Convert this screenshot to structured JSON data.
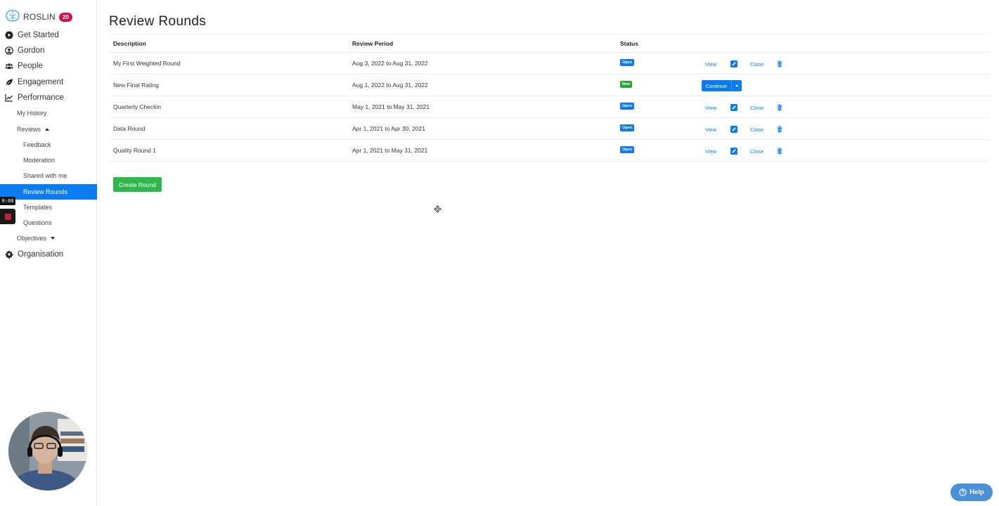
{
  "brand": {
    "name": "ROSLIN",
    "badge": "20"
  },
  "sidebar": {
    "top_items": [
      {
        "label": "Get Started",
        "icon": "play-circle-icon"
      },
      {
        "label": "Gordon",
        "icon": "user-circle-icon"
      },
      {
        "label": "People",
        "icon": "users-icon"
      },
      {
        "label": "Engagement",
        "icon": "leaf-icon"
      },
      {
        "label": "Performance",
        "icon": "line-chart-icon"
      }
    ],
    "performance_items": {
      "my_history": "My History",
      "reviews": "Reviews",
      "review_sub": [
        "Feedback",
        "Moderation",
        "Shared with me",
        "Review Rounds",
        "Templates",
        "Questions"
      ],
      "objectives": "Objectives"
    },
    "organisation": {
      "label": "Organisation",
      "icon": "gear-icon"
    },
    "active_item": "Review Rounds"
  },
  "recorder": {
    "time": "0:00"
  },
  "page": {
    "title": "Review Rounds"
  },
  "table": {
    "headers": {
      "description": "Description",
      "period": "Review Period",
      "status": "Status"
    },
    "rows": [
      {
        "description": "My First Weighted Round",
        "period": "Aug 3, 2022 to Aug 31, 2022",
        "status": "Open"
      },
      {
        "description": "New Final Rating",
        "period": "Aug 1, 2022 to Aug 31, 2022",
        "status": "New"
      },
      {
        "description": "Quarterly Checkin",
        "period": "May 1, 2021 to May 31, 2021",
        "status": "Open"
      },
      {
        "description": "Data Round",
        "period": "Apr 1, 2021 to Apr 30, 2021",
        "status": "Open"
      },
      {
        "description": "Quality Round 1",
        "period": "Apr 1, 2021 to May 31, 2021",
        "status": "Open"
      }
    ],
    "actions": {
      "view": "View",
      "close": "Close",
      "continue": "Continue"
    }
  },
  "buttons": {
    "create_round": "Create Round",
    "help": "Help"
  },
  "colors": {
    "primary": "#0a7cf0",
    "success": "#2fb84a",
    "badge": "#d0104c",
    "help": "#4a90d9"
  }
}
